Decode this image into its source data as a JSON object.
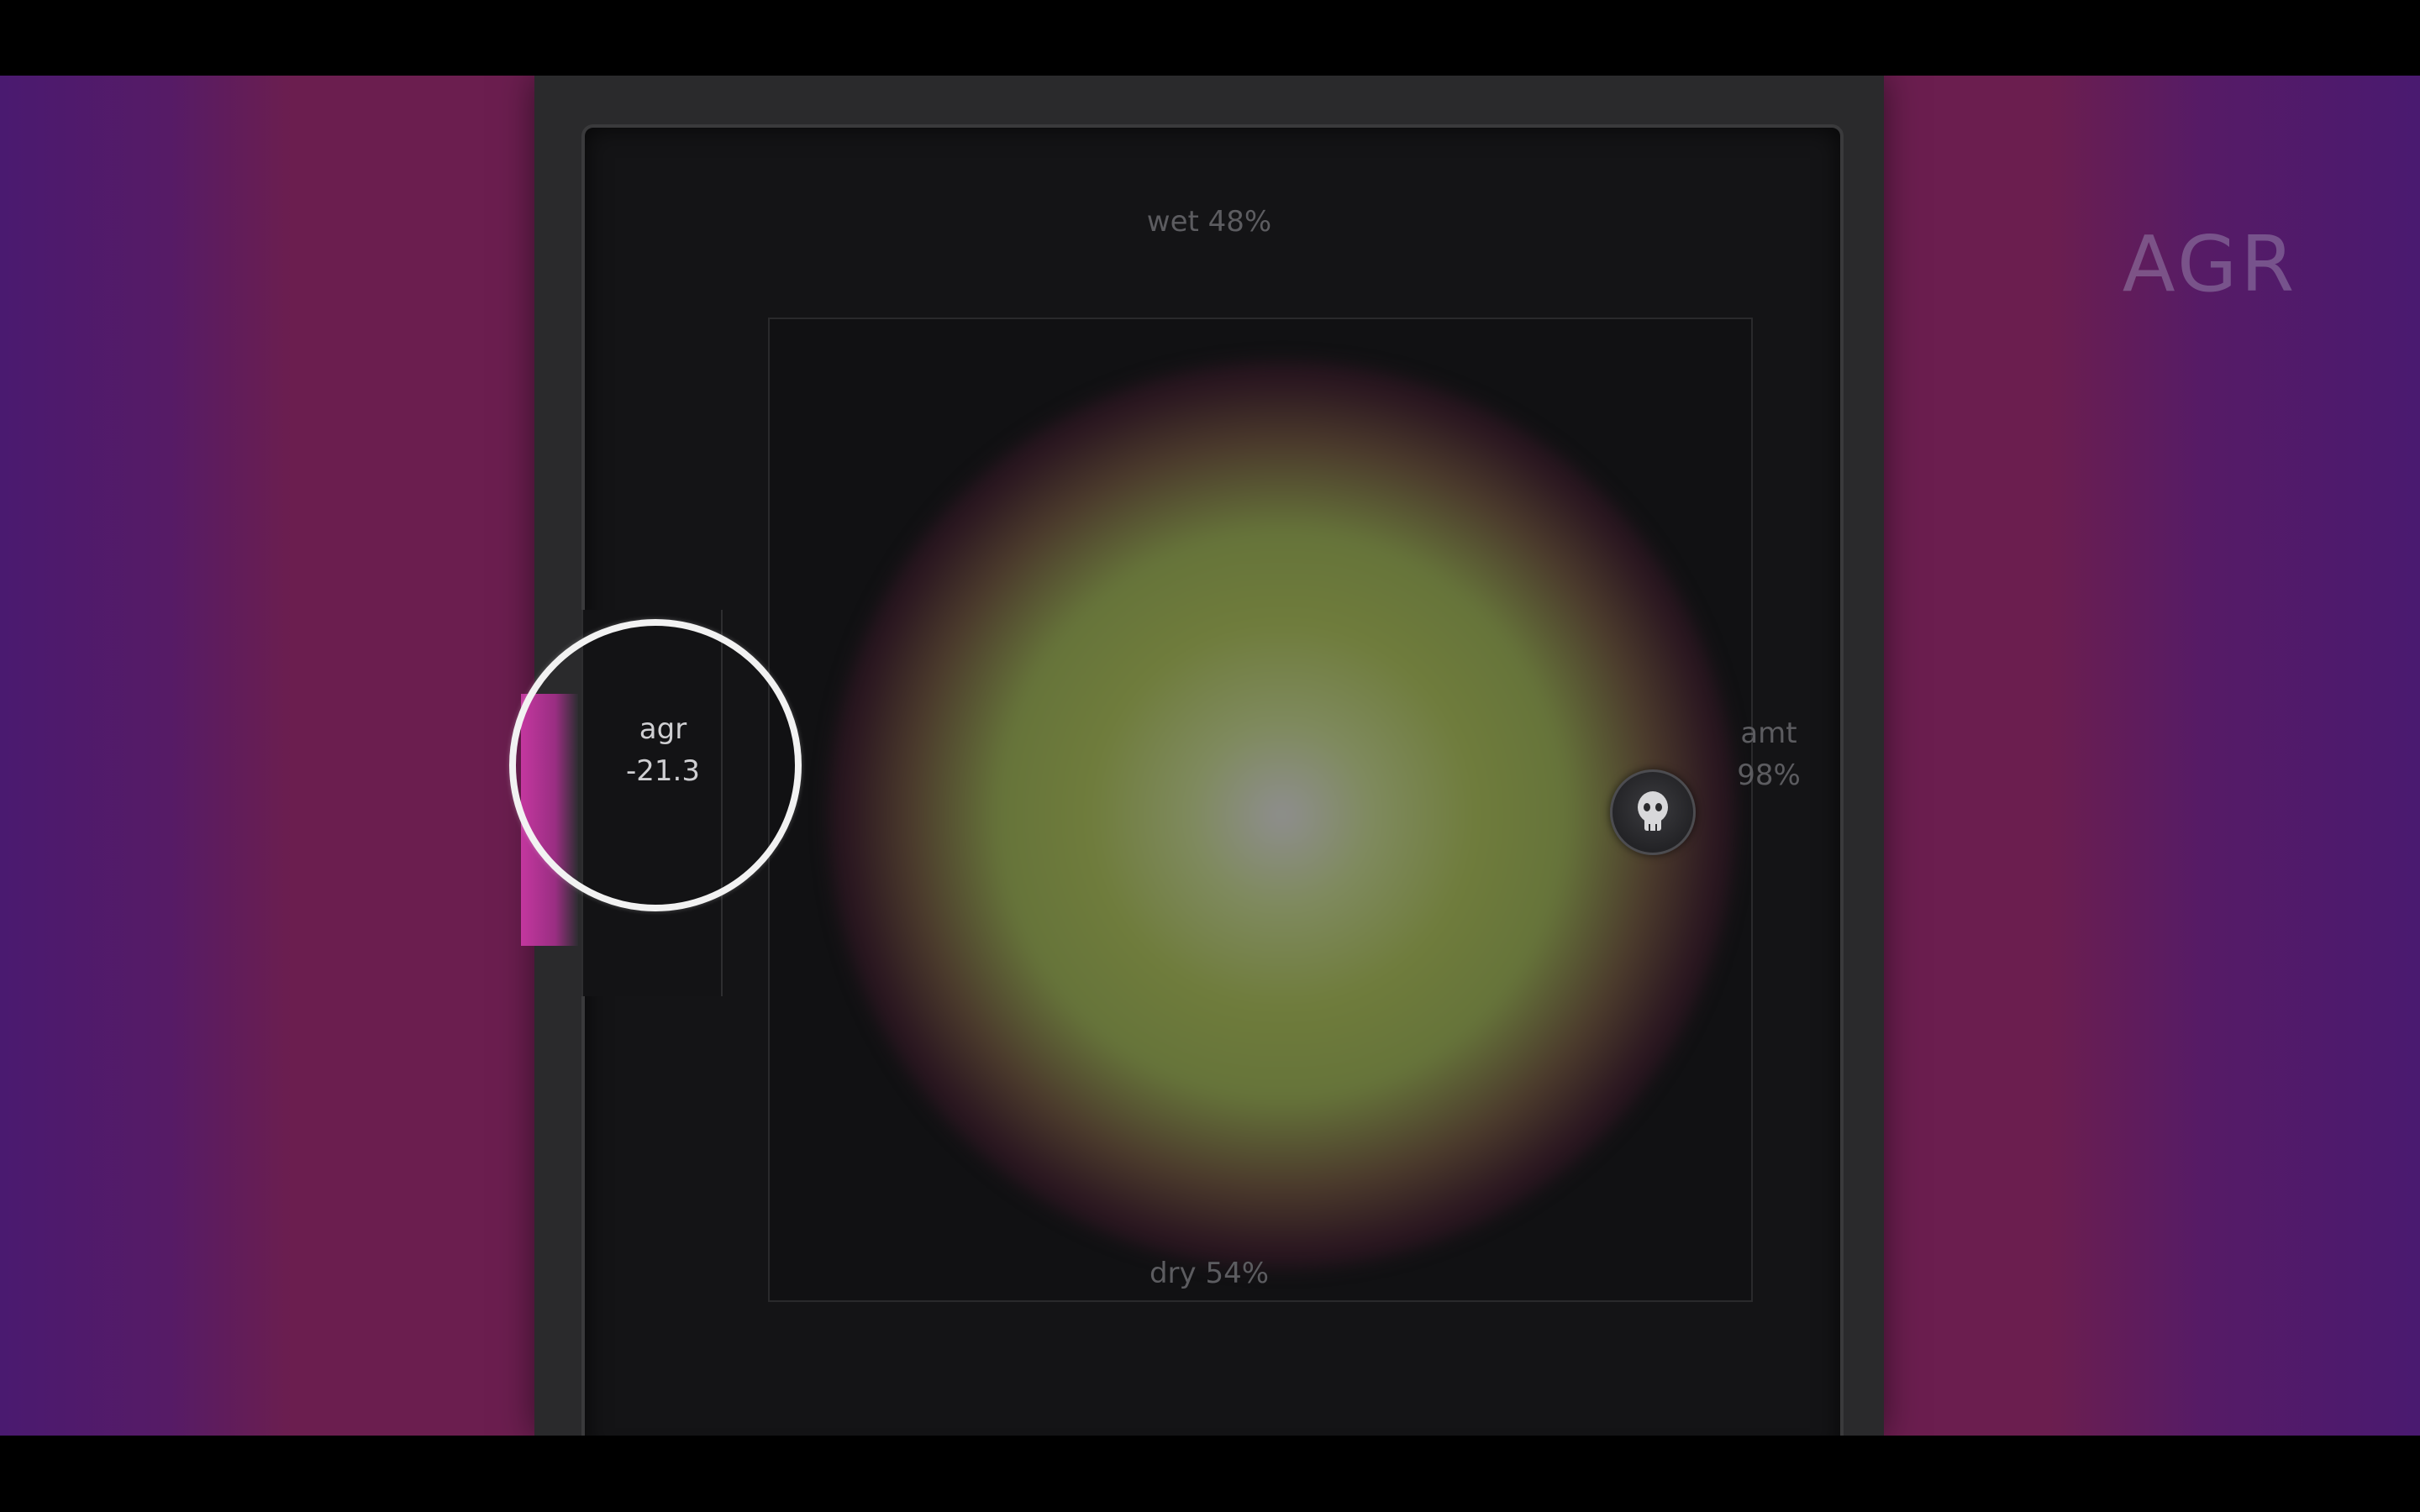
{
  "brand": {
    "logo_text": "AGR"
  },
  "xy_pad": {
    "top_label": "wet 48%",
    "bottom_label": "dry 54%",
    "right_label_name": "amt",
    "right_label_value": "98%"
  },
  "agr_control": {
    "name": "agr",
    "value": "-21.3"
  },
  "colors": {
    "backdrop_purple": "#4a1a70",
    "backdrop_magenta": "#6b1e4f",
    "glow_olive": "#6f7c3c",
    "slider_pink": "#c3379f",
    "highlight_ring": "#f2f2f2"
  },
  "icons": {
    "xy_handle": "skull-knob-icon"
  }
}
